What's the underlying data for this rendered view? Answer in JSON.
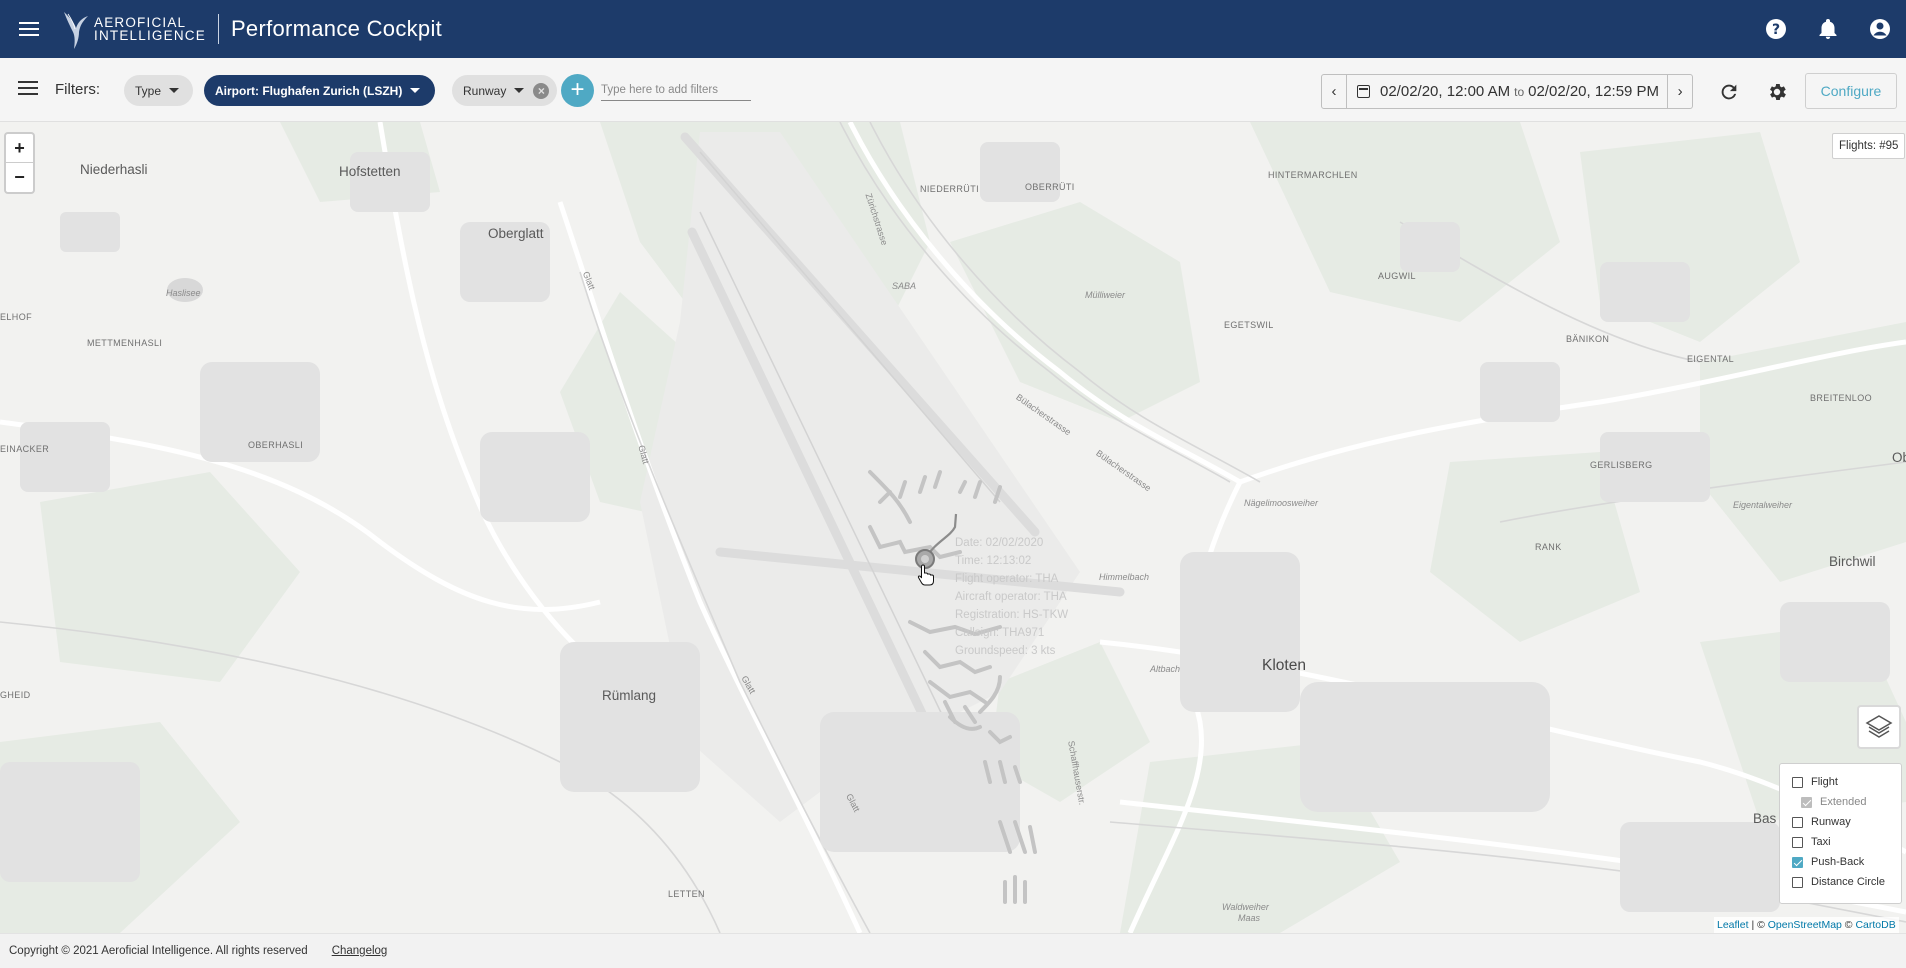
{
  "header": {
    "logo_line1": "Aeroficial",
    "logo_line2": "Intelligence",
    "title": "Performance Cockpit",
    "icons": [
      "help-icon",
      "notifications-icon",
      "account-icon"
    ]
  },
  "filters": {
    "label": "Filters:",
    "chips": {
      "type": "Type",
      "airport": "Airport: Flughafen Zurich (LSZH)",
      "runway": "Runway"
    },
    "add_label": "+",
    "input_placeholder": "Type here to add filters",
    "date_from": "02/02/20, 12:00 AM",
    "date_to_word": "to",
    "date_to": "02/02/20, 12:59 PM",
    "configure_label": "Configure"
  },
  "map": {
    "flights_count": "Flights: #95",
    "zoom_in": "+",
    "zoom_out": "−",
    "places": {
      "niederhasli": "Niederhasli",
      "hofstetten": "Hofstetten",
      "oberglatt": "Oberglatt",
      "niederruti": "NIEDERRÜTI",
      "oberruti": "OBERRÜTI",
      "hintermarchlen": "HINTERMARCHLEN",
      "zurichstrasse": "Zürichstrasse",
      "hasliese": "Haslisee",
      "elhof": "ELHOF",
      "mettmenhasli": "METTMENHASLI",
      "saba": "SABA",
      "mulliweier": "Mülliweier",
      "augwil": "AUGWIL",
      "egetswil": "EGETSWIL",
      "banikon": "BÄNIKON",
      "eigental": "EIGENTAL",
      "breitenloo": "BREITENLOO",
      "einacker": "EINACKER",
      "oberhasli": "OBERHASLI",
      "glatt1": "Glatt",
      "glatt2": "Glatt",
      "glatt3": "Glatt",
      "glatt4": "Glatt",
      "glatt5": "Glatt",
      "bulacherstrasse1": "Bülacherstrasse",
      "bulacherstrasse2": "Bülacherstrasse",
      "gerlisberg": "GERLISBERG",
      "eigentalweiher": "Eigentalweiher",
      "ob": "Ob",
      "nagelimoosweiher": "Nägelimoosweiher",
      "himmelbach": "Himmelbach",
      "rank": "RANK",
      "birchwil": "Birchwil",
      "altbach": "Altbach",
      "kloten": "Kloten",
      "schaffhauserstrasse": "Schaffhauserstr.",
      "gheid": "GHEID",
      "rumlang": "Rümlang",
      "bas": "Bas",
      "letten": "LETTEN",
      "waldweiher": "Waldweiher",
      "maas": "Maas"
    },
    "tooltip": {
      "line1": "Date: 02/02/2020",
      "line2": "Time: 12:13:02",
      "line3": "Flight operator: THA",
      "line4": "Aircraft operator: THA",
      "line5": "Registration: HS-TKW",
      "line6": "Callsign: THA971",
      "line7": "Groundspeed: 3 kts"
    },
    "layers": {
      "flight": "Flight",
      "extended": "Extended",
      "runway": "Runway",
      "taxi": "Taxi",
      "push_back": "Push-Back",
      "distance_circle": "Distance Circle"
    },
    "attribution": {
      "leaflet": "Leaflet",
      "sep1": " | © ",
      "osm": "OpenStreetMap",
      "sep2": " © ",
      "carto": "CartoDB"
    }
  },
  "footer": {
    "copyright": "Copyright © 2021 Aeroficial Intelligence. All rights reserved",
    "changelog": "Changelog"
  },
  "colors": {
    "header_bg": "#1d3b6a",
    "accent": "#4fa9c4"
  }
}
